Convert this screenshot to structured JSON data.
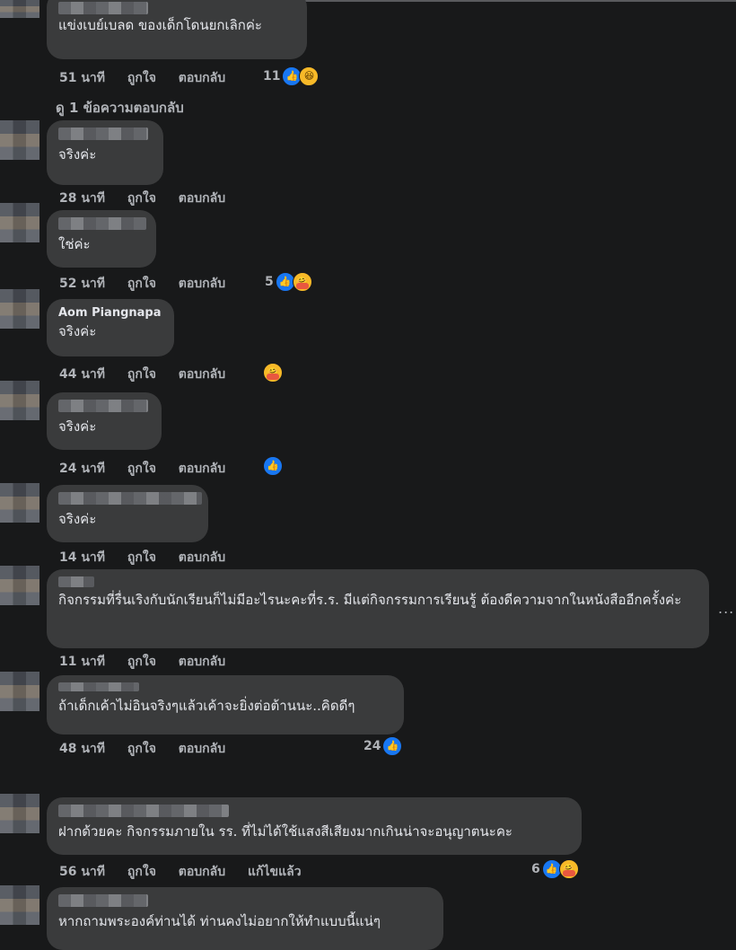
{
  "labels": {
    "like": "ถูกใจ",
    "reply": "ตอบกลับ",
    "edited": "แก้ไขแล้ว",
    "view_replies": "ดู 1 ข้อความตอบกลับ",
    "more_icon": "..."
  },
  "comments": [
    {
      "author": "",
      "text": "แข่งเบย์เบลด ของเด็กโดนยกเลิกค่ะ",
      "time": "51 นาที",
      "reactions": "11",
      "icons": [
        "like",
        "haha"
      ]
    },
    {
      "author": "",
      "text": "จริงค่ะ",
      "time": "28 นาที",
      "reactions": "",
      "icons": []
    },
    {
      "author": "",
      "text": "ใช่ค่ะ",
      "time": "52 นาที",
      "reactions": "5",
      "icons": [
        "like",
        "care"
      ]
    },
    {
      "author": "Aom Piangnapa",
      "text": "จริงค่ะ",
      "time": "44 นาที",
      "reactions": "",
      "icons": [
        "care"
      ]
    },
    {
      "author": "",
      "text": "จริงค่ะ",
      "time": "24 นาที",
      "reactions": "",
      "icons": [
        "like"
      ]
    },
    {
      "author": "",
      "text": "จริงค่ะ",
      "time": "14 นาที",
      "reactions": "",
      "icons": []
    },
    {
      "author": "",
      "text": "กิจกรรมที่รื่นเริงกับนักเรียนก็ไม่มีอะไรนะคะที่ร.ร. มีแต่กิจกรรมการเรียนรู้ ต้องดีความจากในหนังสืออีกครั้งค่ะ",
      "time": "11 นาที",
      "reactions": "",
      "icons": []
    },
    {
      "author": "",
      "text": "ถ้าเด็กเค้าไม่อินจริงๆแล้วเค้าจะยิ่งต่อต้านนะ..คิดดีๆ",
      "time": "48 นาที",
      "reactions": "24",
      "icons": [
        "like"
      ]
    },
    {
      "author": "",
      "text": "ฝากด้วยคะ กิจกรรมภายใน รร. ที่ไม่ได้ใช้แสงสีเสียงมากเกินน่าจะอนุญาตนะคะ",
      "time": "56 นาที",
      "reactions": "6",
      "icons": [
        "like",
        "care"
      ]
    },
    {
      "author": "",
      "text": "หากถามพระองค์ท่านได้ ท่านคงไม่อยากให้ทำแบบนี้แน่ๆ",
      "time": "",
      "reactions": "",
      "icons": []
    }
  ]
}
